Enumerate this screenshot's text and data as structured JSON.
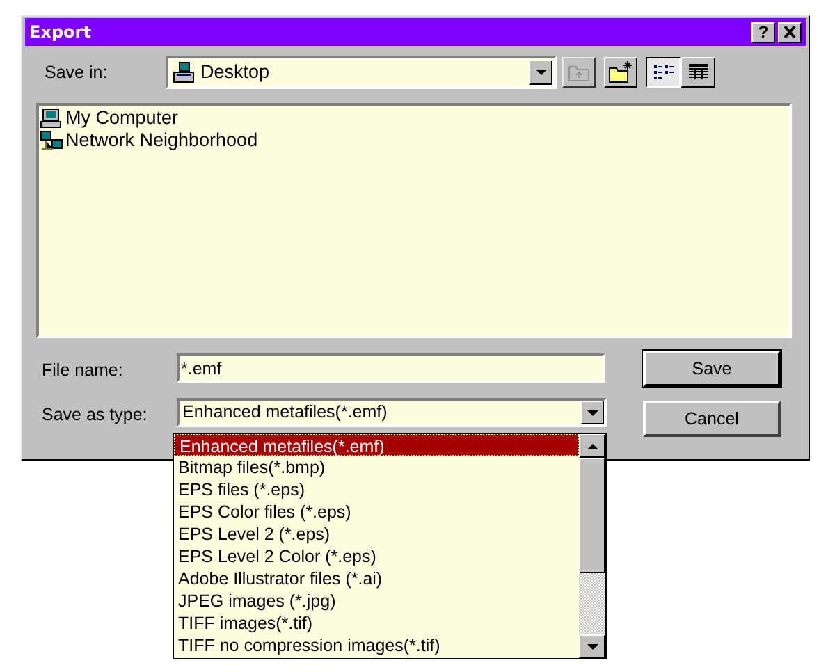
{
  "window": {
    "title": "Export",
    "help_button": "?"
  },
  "save_in": {
    "label": "Save in:",
    "value": "Desktop"
  },
  "toolbar": [
    {
      "kind": "up-folder",
      "disabled": true
    },
    {
      "kind": "new-folder",
      "disabled": false
    }
  ],
  "views": [
    {
      "kind": "list",
      "selected": true
    },
    {
      "kind": "details",
      "selected": false
    }
  ],
  "files": [
    {
      "name": "My Computer",
      "kind": "computer"
    },
    {
      "name": "Network Neighborhood",
      "kind": "network"
    }
  ],
  "file_name": {
    "label": "File name:",
    "value": "*.emf"
  },
  "save_as_type": {
    "label": "Save as type:",
    "value": "Enhanced metafiles(*.emf)",
    "expanded": true,
    "options": [
      {
        "label": "Enhanced metafiles(*.emf)",
        "selected": true
      },
      {
        "label": "Bitmap files(*.bmp)",
        "selected": false
      },
      {
        "label": "EPS files (*.eps)",
        "selected": false
      },
      {
        "label": "EPS Color files (*.eps)",
        "selected": false
      },
      {
        "label": "EPS Level 2 (*.eps)",
        "selected": false
      },
      {
        "label": "EPS Level 2 Color (*.eps)",
        "selected": false
      },
      {
        "label": "Adobe Illustrator files (*.ai)",
        "selected": false
      },
      {
        "label": "JPEG images (*.jpg)",
        "selected": false
      },
      {
        "label": "TIFF images(*.tif)",
        "selected": false
      },
      {
        "label": "TIFF no compression images(*.tif)",
        "selected": false
      }
    ]
  },
  "buttons": [
    {
      "label": "Save",
      "default": true
    },
    {
      "label": "Cancel",
      "default": false
    }
  ]
}
